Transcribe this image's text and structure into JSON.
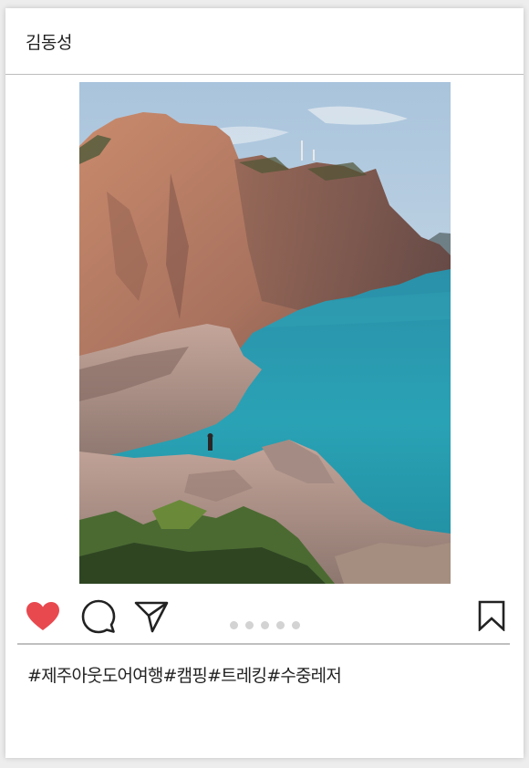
{
  "post": {
    "username": "김동성",
    "caption": "#제주아웃도어여행#캠핑#트레킹#수중레저",
    "carousel_count": 5
  },
  "colors": {
    "like": "#e8494f",
    "icon_stroke": "#222222",
    "dot": "#d3d3d3"
  },
  "icons": {
    "like": "heart-icon",
    "comment": "speech-bubble-icon",
    "share": "paper-plane-icon",
    "save": "bookmark-icon"
  }
}
